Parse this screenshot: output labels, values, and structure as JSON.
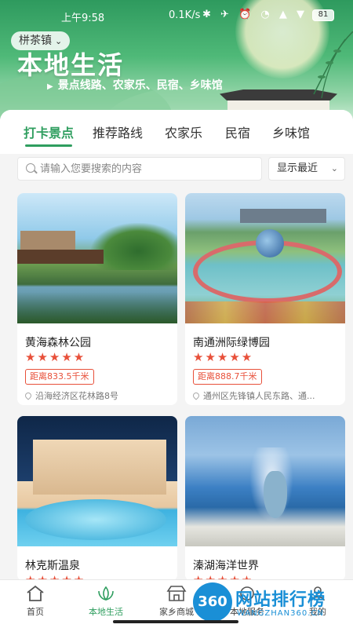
{
  "status": {
    "time": "上午9:58",
    "network": "0.1K/s",
    "icons": "✱ ✈ ⏰ ◔ ▲ ▼",
    "battery": "81"
  },
  "header": {
    "town": "栟茶镇",
    "title": "本地生活",
    "subtitle": "景点线路、农家乐、民宿、乡味馆"
  },
  "tabs": [
    {
      "label": "打卡景点",
      "active": true
    },
    {
      "label": "推荐路线"
    },
    {
      "label": "农家乐"
    },
    {
      "label": "民宿"
    },
    {
      "label": "乡味馆"
    }
  ],
  "search": {
    "placeholder": "请输入您要搜索的内容",
    "sort_label": "显示最近"
  },
  "cards": [
    {
      "name": "黄海森林公园",
      "stars": "★★★★★",
      "distance": "距离833.5千米",
      "address": "沿海经济区花林路8号",
      "image": "lake-scene"
    },
    {
      "name": "南通洲际绿博园",
      "stars": "★★★★★",
      "distance": "距离888.7千米",
      "address": "通州区先锋镇人民东路、通...",
      "image": "park-scene"
    },
    {
      "name": "林克斯温泉",
      "stars": "★★★★★",
      "image": "hotel-scene"
    },
    {
      "name": "溱湖海洋世界",
      "stars": "★★★★★",
      "image": "ocean-scene"
    }
  ],
  "bottom_nav": [
    {
      "label": "首页",
      "icon": "home-icon"
    },
    {
      "label": "本地生活",
      "icon": "lotus-icon",
      "active": true
    },
    {
      "label": "家乡商城",
      "icon": "shop-icon"
    },
    {
      "label": "本地服务",
      "icon": "service-icon"
    },
    {
      "label": "我的",
      "icon": "profile-icon"
    }
  ],
  "watermark": {
    "logo": "360",
    "cn": "网站排行榜",
    "en": "WANGZHAN360.CN"
  },
  "colors": {
    "accent": "#2f9e5f",
    "star": "#e8503a",
    "watermark": "#1a8fd6"
  }
}
